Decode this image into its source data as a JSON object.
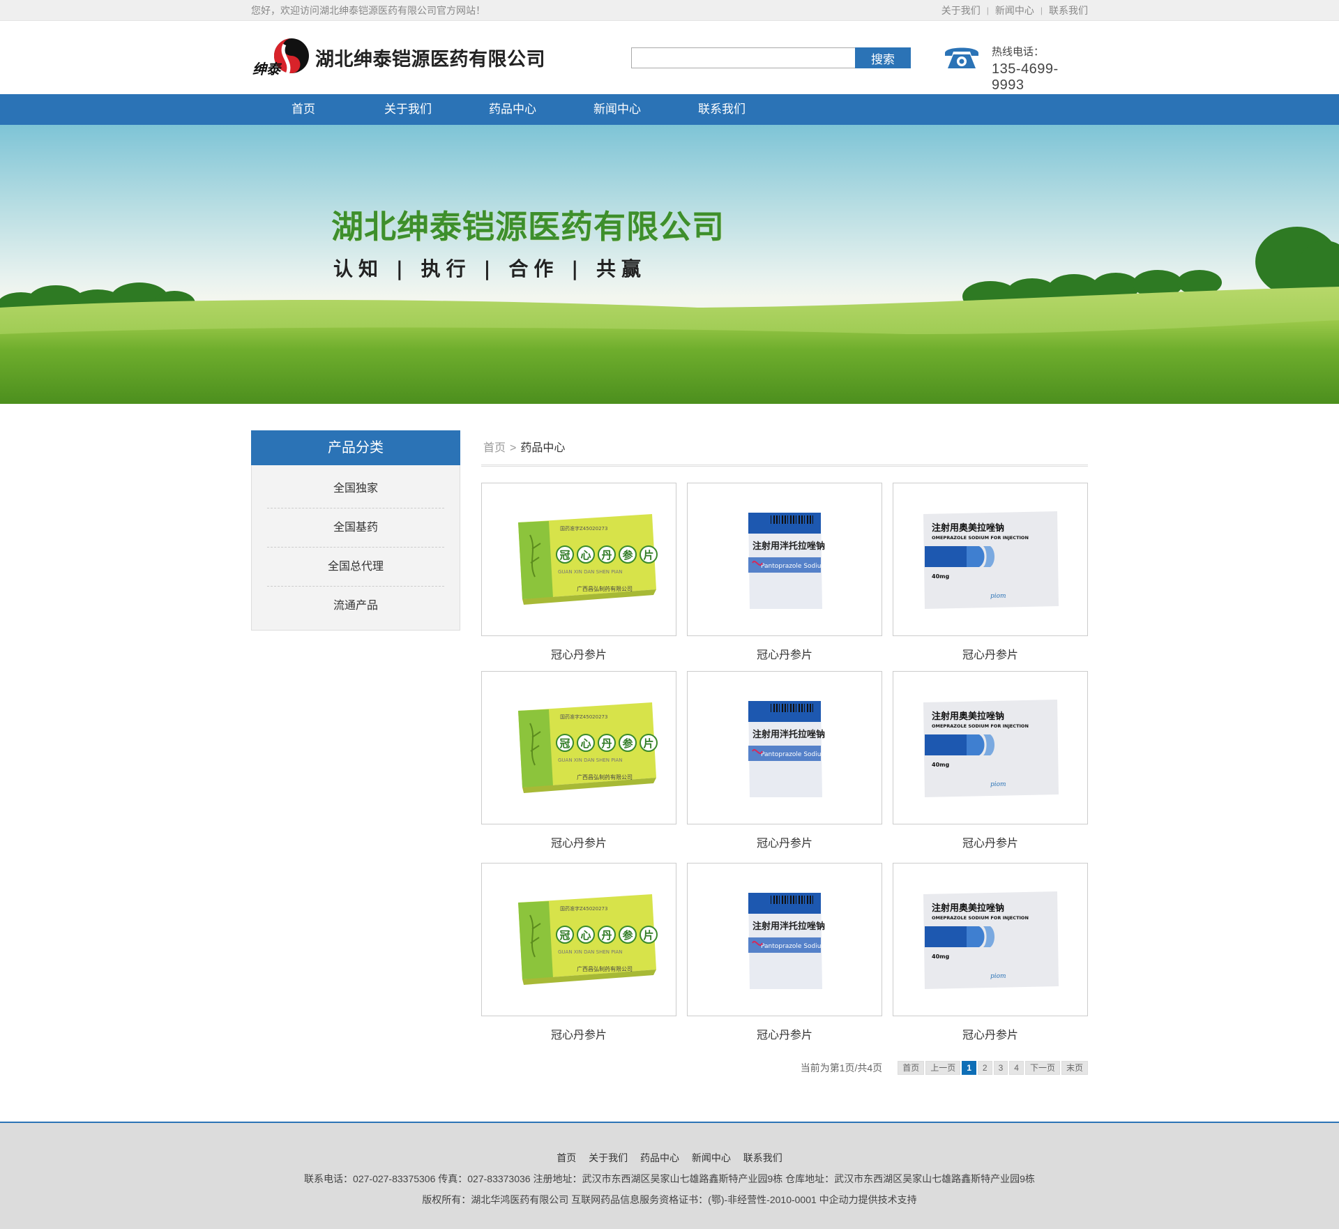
{
  "topbar": {
    "welcome": "您好，欢迎访问湖北绅泰铠源医药有限公司官方网站！",
    "links": [
      "关于我们",
      "新闻中心",
      "联系我们"
    ]
  },
  "header": {
    "company_name": "湖北绅泰铠源医药有限公司",
    "search_placeholder": "",
    "search_button": "搜索",
    "hotline_label": "热线电话：",
    "hotline_number": "135-4699-9993"
  },
  "nav": [
    "首页",
    "关于我们",
    "药品中心",
    "新闻中心",
    "联系我们"
  ],
  "banner": {
    "title": "湖北绅泰铠源医药有限公司",
    "slogan": "认知 | 执行 | 合作 | 共赢"
  },
  "sidebar": {
    "title": "产品分类",
    "items": [
      "全国独家",
      "全国基药",
      "全国总代理",
      "流通产品"
    ]
  },
  "breadcrumb": {
    "home": "首页",
    "separator": ">",
    "current": "药品中心"
  },
  "products": [
    {
      "caption": "冠心丹参片",
      "image": "yellow-green-box"
    },
    {
      "caption": "冠心丹参片",
      "image": "blue-white-vial-box"
    },
    {
      "caption": "冠心丹参片",
      "image": "white-blue-box"
    },
    {
      "caption": "冠心丹参片",
      "image": "yellow-green-box"
    },
    {
      "caption": "冠心丹参片",
      "image": "blue-white-vial-box"
    },
    {
      "caption": "冠心丹参片",
      "image": "white-blue-box"
    },
    {
      "caption": "冠心丹参片",
      "image": "yellow-green-box"
    },
    {
      "caption": "冠心丹参片",
      "image": "blue-white-vial-box"
    },
    {
      "caption": "冠心丹参片",
      "image": "white-blue-box"
    }
  ],
  "box_text": {
    "green": {
      "name": [
        "冠",
        "心",
        "丹",
        "参",
        "片"
      ],
      "pinyin": "GUAN  XIN  DAN  SHEN  PIAN",
      "maker": "广西昌弘制药有限公司",
      "approval": "国药准字Z45020273"
    },
    "vial": {
      "name": "注射用泮托拉唑钠",
      "en": "Pantoprazole Sodium"
    },
    "white": {
      "name": "注射用奥美拉唑钠",
      "en": "OMEPRAZOLE SODIUM FOR INJECTION",
      "dose": "40mg",
      "brand": "piom"
    }
  },
  "pager": {
    "info": "当前为第1页/共4页",
    "first": "首页",
    "prev": "上一页",
    "pages": [
      "1",
      "2",
      "3",
      "4"
    ],
    "current": "1",
    "next": "下一页",
    "last": "末页"
  },
  "footer": {
    "links": [
      "首页",
      "关于我们",
      "药品中心",
      "新闻中心",
      "联系我们"
    ],
    "contact": "联系电话：027-027-83375306 传真：027-83373036 注册地址：武汉市东西湖区吴家山七雄路鑫斯特产业园9栋 仓库地址：武汉市东西湖区吴家山七雄路鑫斯特产业园9栋",
    "copyright": "版权所有：湖北华鸿医药有限公司 互联网药品信息服务资格证书：(鄂)-非经营性-2010-0001 中企动力提供技术支持"
  },
  "colors": {
    "primary": "#2b73b6",
    "banner_title": "#3d8f2c",
    "footer_bg": "#dcdcdc",
    "pager_active": "#0e6eb6"
  }
}
